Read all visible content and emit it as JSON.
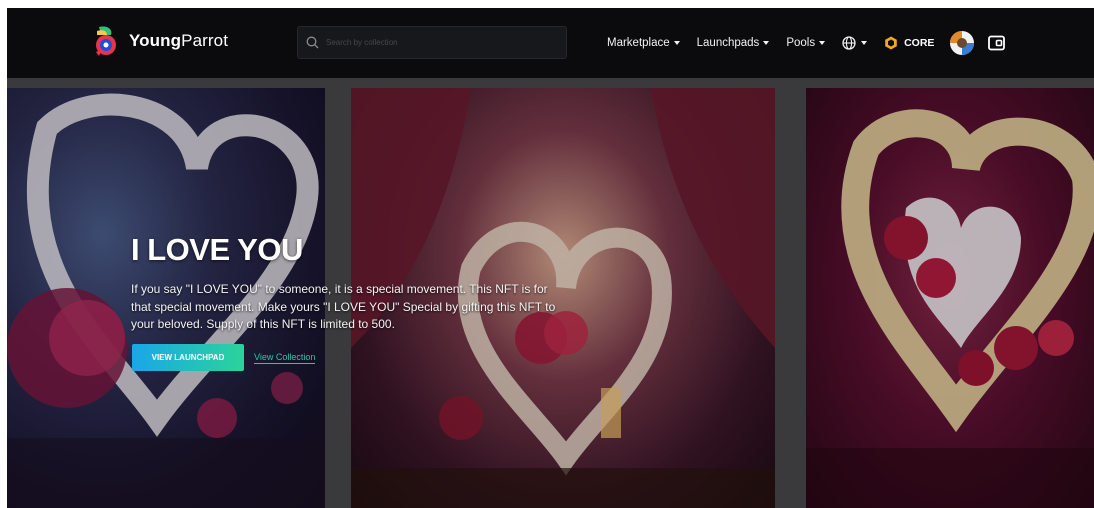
{
  "brand": {
    "name_bold": "Young",
    "name_rest": "Parrot",
    "logo_icon": "parrot-logo-icon"
  },
  "search": {
    "placeholder": "Search by collection",
    "icon": "search-icon"
  },
  "nav": {
    "items": [
      {
        "label": "Marketplace"
      },
      {
        "label": "Launchpads"
      },
      {
        "label": "Pools"
      }
    ],
    "language_icon": "globe-icon",
    "chain_label": "CORE",
    "chain_icon": "core-chain-icon",
    "wallet_icon": "wallet-icon"
  },
  "hero": {
    "title": "I LOVE YOU",
    "description": "If you say \"I LOVE YOU\" to someone, it is a special movement. This NFT is for that special movement. Make yours \"I LOVE YOU\" Special by gifting this NFT to your beloved. Supply of this NFT is limited to 500.",
    "primary_button": "VIEW LAUNCHPAD",
    "secondary_link": "View Collection"
  },
  "colors": {
    "navbar_bg": "#0b0b0d",
    "accent_gradient_start": "#1aa6e8",
    "accent_gradient_end": "#2bd49a",
    "link": "#27c9a0",
    "chain_orange": "#f5a623"
  }
}
